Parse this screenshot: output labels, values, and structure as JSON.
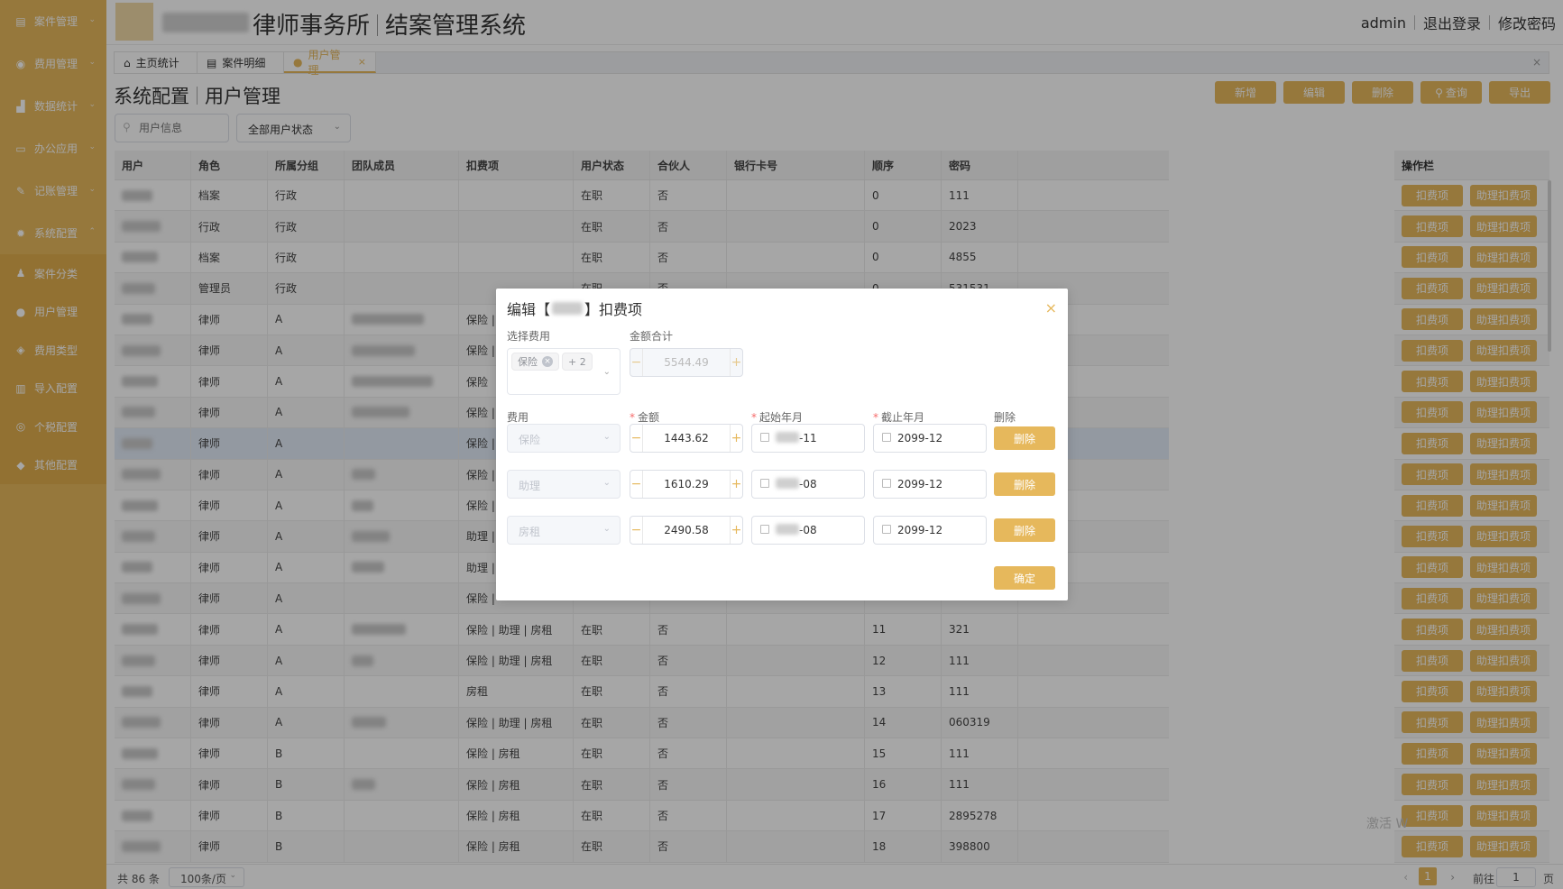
{
  "sidebar": {
    "items": [
      {
        "label": "案件管理",
        "icon": "case-icon"
      },
      {
        "label": "费用管理",
        "icon": "money-icon"
      },
      {
        "label": "数据统计",
        "icon": "chart-icon"
      },
      {
        "label": "办公应用",
        "icon": "monitor-icon"
      },
      {
        "label": "记账管理",
        "icon": "ledger-icon"
      },
      {
        "label": "系统配置",
        "icon": "gear-icon"
      }
    ],
    "subitems": [
      {
        "label": "案件分类",
        "icon": "users-icon"
      },
      {
        "label": "用户管理",
        "icon": "user-icon"
      },
      {
        "label": "费用类型",
        "icon": "layers-icon"
      },
      {
        "label": "导入配置",
        "icon": "book-icon"
      },
      {
        "label": "个税配置",
        "icon": "tax-icon"
      },
      {
        "label": "其他配置",
        "icon": "tag-icon"
      }
    ]
  },
  "header": {
    "title": "律师事务所",
    "subtitle": "结案管理系统",
    "user": "admin",
    "logout": "退出登录",
    "change_password": "修改密码"
  },
  "tabs": [
    {
      "label": "主页统计",
      "icon": "home-icon"
    },
    {
      "label": "案件明细",
      "icon": "doc-icon"
    },
    {
      "label": "用户管理",
      "icon": "user-icon"
    }
  ],
  "tab_close": "×",
  "breadcrumb": {
    "parent": "系统配置",
    "current": "用户管理"
  },
  "toolbar": {
    "add": "新增",
    "edit": "编辑",
    "delete": "删除",
    "query": "查询",
    "export": "导出"
  },
  "filters": {
    "search_placeholder": "用户信息",
    "status": "全部用户状态"
  },
  "table": {
    "headers": [
      "用户",
      "角色",
      "所属分组",
      "团队成员",
      "扣费项",
      "用户状态",
      "合伙人",
      "银行卡号",
      "顺序",
      "密码"
    ],
    "rows": [
      {
        "role": "档案",
        "group": "行政",
        "items": "",
        "status": "在职",
        "partner": "否",
        "order": "0",
        "pwd": "111"
      },
      {
        "role": "行政",
        "group": "行政",
        "items": "",
        "status": "在职",
        "partner": "否",
        "order": "0",
        "pwd": "2023"
      },
      {
        "role": "档案",
        "group": "行政",
        "items": "",
        "status": "在职",
        "partner": "否",
        "order": "0",
        "pwd": "4855"
      },
      {
        "role": "管理员",
        "group": "行政",
        "items": "",
        "status": "在职",
        "partner": "否",
        "order": "0",
        "pwd": "531531"
      },
      {
        "role": "律师",
        "group": "A",
        "items": "保险 |",
        "status": "",
        "partner": "",
        "order": "",
        "pwd": ""
      },
      {
        "role": "律师",
        "group": "A",
        "items": "保险 |",
        "status": "",
        "partner": "",
        "order": "",
        "pwd": ""
      },
      {
        "role": "律师",
        "group": "A",
        "items": "保险",
        "status": "",
        "partner": "",
        "order": "",
        "pwd": ""
      },
      {
        "role": "律师",
        "group": "A",
        "items": "保险 |",
        "status": "",
        "partner": "",
        "order": "",
        "pwd": ""
      },
      {
        "role": "律师",
        "group": "A",
        "items": "保险 |",
        "status": "",
        "partner": "",
        "order": "",
        "pwd": ""
      },
      {
        "role": "律师",
        "group": "A",
        "items": "保险 |",
        "status": "",
        "partner": "",
        "order": "",
        "pwd": ""
      },
      {
        "role": "律师",
        "group": "A",
        "items": "保险 |",
        "status": "",
        "partner": "",
        "order": "",
        "pwd": ""
      },
      {
        "role": "律师",
        "group": "A",
        "items": "助理 |",
        "status": "",
        "partner": "",
        "order": "",
        "pwd": ""
      },
      {
        "role": "律师",
        "group": "A",
        "items": "助理 |",
        "status": "",
        "partner": "",
        "order": "",
        "pwd": ""
      },
      {
        "role": "律师",
        "group": "A",
        "items": "保险 |",
        "status": "",
        "partner": "",
        "order": "",
        "pwd": ""
      },
      {
        "role": "律师",
        "group": "A",
        "items": "保险 | 助理 | 房租",
        "status": "在职",
        "partner": "否",
        "order": "11",
        "pwd": "321"
      },
      {
        "role": "律师",
        "group": "A",
        "items": "保险 | 助理 | 房租",
        "status": "在职",
        "partner": "否",
        "order": "12",
        "pwd": "111"
      },
      {
        "role": "律师",
        "group": "A",
        "items": "房租",
        "status": "在职",
        "partner": "否",
        "order": "13",
        "pwd": "111"
      },
      {
        "role": "律师",
        "group": "A",
        "items": "保险 | 助理 | 房租",
        "status": "在职",
        "partner": "否",
        "order": "14",
        "pwd": "060319"
      },
      {
        "role": "律师",
        "group": "B",
        "items": "保险 | 房租",
        "status": "在职",
        "partner": "否",
        "order": "15",
        "pwd": "111"
      },
      {
        "role": "律师",
        "group": "B",
        "items": "保险 | 房租",
        "status": "在职",
        "partner": "否",
        "order": "16",
        "pwd": "111"
      },
      {
        "role": "律师",
        "group": "B",
        "items": "保险 | 房租",
        "status": "在职",
        "partner": "否",
        "order": "17",
        "pwd": "2895278"
      },
      {
        "role": "律师",
        "group": "B",
        "items": "保险 | 房租",
        "status": "在职",
        "partner": "否",
        "order": "18",
        "pwd": "398800"
      }
    ]
  },
  "ops": {
    "header": "操作栏",
    "btn1": "扣费项",
    "btn2": "助理扣费项"
  },
  "footer": {
    "total": "共 86 条",
    "page_size": "100条/页",
    "current_page": "1",
    "goto_label": "前往",
    "goto_value": "1",
    "page_unit": "页"
  },
  "watermark": "激活 W",
  "dialog": {
    "title_prefix": "编辑【",
    "title_suffix": "】扣费项",
    "close": "×",
    "select_label": "选择费用",
    "chip1": "保险",
    "chip2": "+ 2",
    "sum_label": "金额合计",
    "sum_value": "5544.49",
    "col_fee": "费用",
    "col_amount": "金额",
    "col_start": "起始年月",
    "col_end": "截止年月",
    "col_delete": "删除",
    "rows": [
      {
        "fee": "保险",
        "amount": "1443.62",
        "start_suffix": "-11",
        "end": "2099-12",
        "del": "删除"
      },
      {
        "fee": "助理",
        "amount": "1610.29",
        "start_suffix": "-08",
        "end": "2099-12",
        "del": "删除"
      },
      {
        "fee": "房租",
        "amount": "2490.58",
        "start_suffix": "-08",
        "end": "2099-12",
        "del": "删除"
      }
    ],
    "confirm": "确定"
  },
  "colors": {
    "accent": "#e6b85c",
    "sidebar": "#e6b85c",
    "danger": "#f56c6c"
  }
}
